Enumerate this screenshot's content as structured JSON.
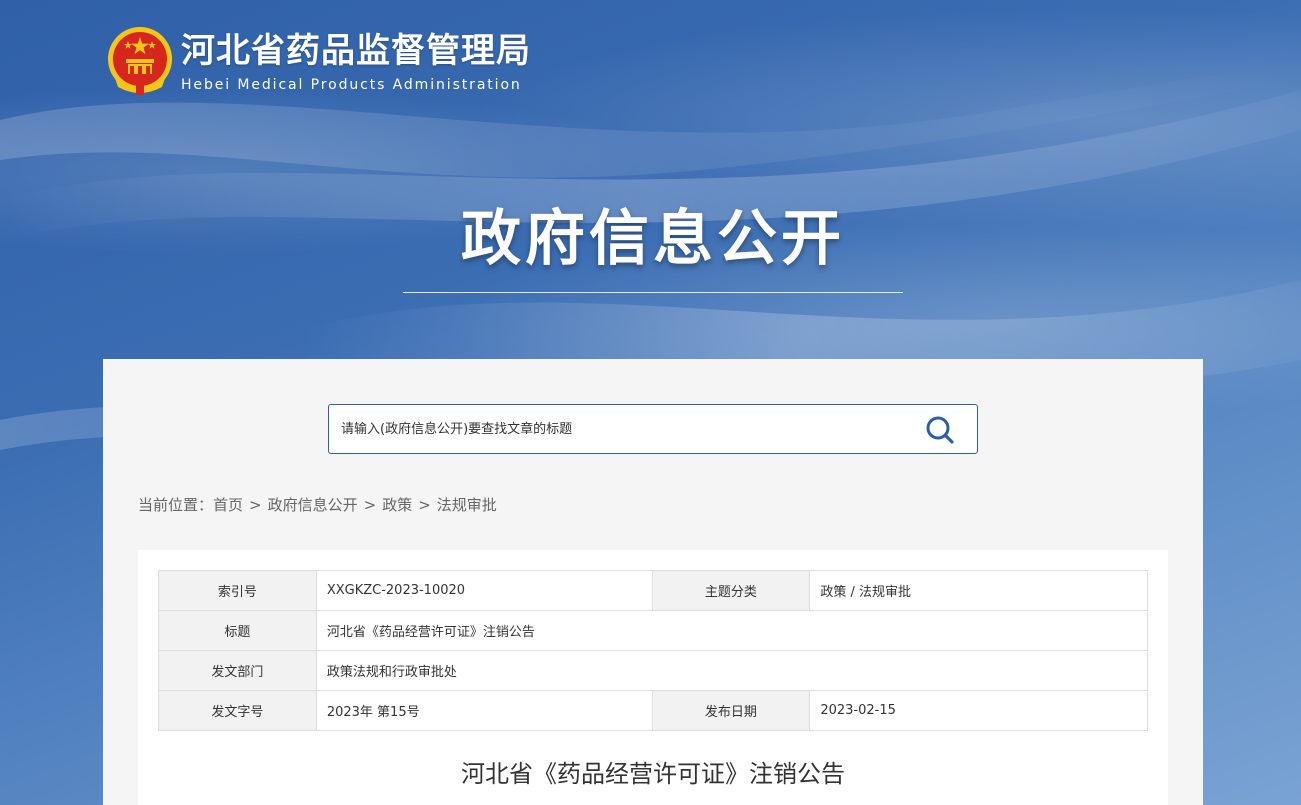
{
  "header": {
    "site_name": "河北省药品监督管理局",
    "site_name_en": "Hebei Medical Products Administration",
    "emblem_icon": "national-emblem-icon"
  },
  "banner": {
    "heading": "政府信息公开"
  },
  "search": {
    "placeholder": "请输入(政府信息公开)要查找文章的标题",
    "icon": "search-icon"
  },
  "breadcrumb": {
    "prefix": "当前位置：",
    "items": [
      "首页",
      "政府信息公开",
      "政策",
      "法规审批"
    ],
    "separator": ">"
  },
  "meta": {
    "index_label": "索引号",
    "index_value": "XXGKZC-2023-10020",
    "category_label": "主题分类",
    "category_value": "政策 / 法规审批",
    "title_label": "标题",
    "title_value": "河北省《药品经营许可证》注销公告",
    "dept_label": "发文部门",
    "dept_value": "政策法规和行政审批处",
    "docno_label": "发文字号",
    "docno_value": "2023年 第15号",
    "date_label": "发布日期",
    "date_value": "2023-02-15"
  },
  "article": {
    "title": "河北省《药品经营许可证》注销公告"
  },
  "colors": {
    "brand_blue": "#2b5ea8",
    "emblem_red": "#d7261e",
    "emblem_gold": "#f5c518"
  }
}
